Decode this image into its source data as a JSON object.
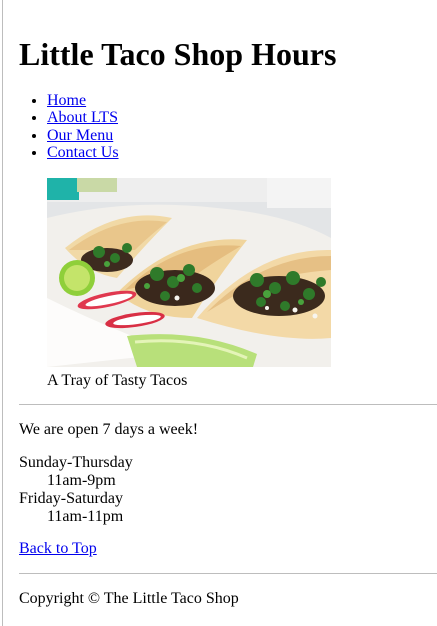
{
  "header": {
    "title": "Little Taco Shop Hours"
  },
  "nav": {
    "items": [
      {
        "label": "Home"
      },
      {
        "label": "About LTS"
      },
      {
        "label": "Our Menu"
      },
      {
        "label": "Contact Us"
      }
    ]
  },
  "hero": {
    "caption": "A Tray of Tasty Tacos",
    "icon": "taco-photo"
  },
  "main": {
    "open_text": "We are open 7 days a week!",
    "hours": [
      {
        "days": "Sunday-Thursday",
        "time": "11am-9pm"
      },
      {
        "days": "Friday-Saturday",
        "time": "11am-11pm"
      }
    ],
    "back_to_top": "Back to Top"
  },
  "footer": {
    "copyright": "Copyright © The Little Taco Shop"
  },
  "colors": {
    "link": "#0000ee",
    "rule": "#bdbdbd",
    "text": "#000000"
  }
}
